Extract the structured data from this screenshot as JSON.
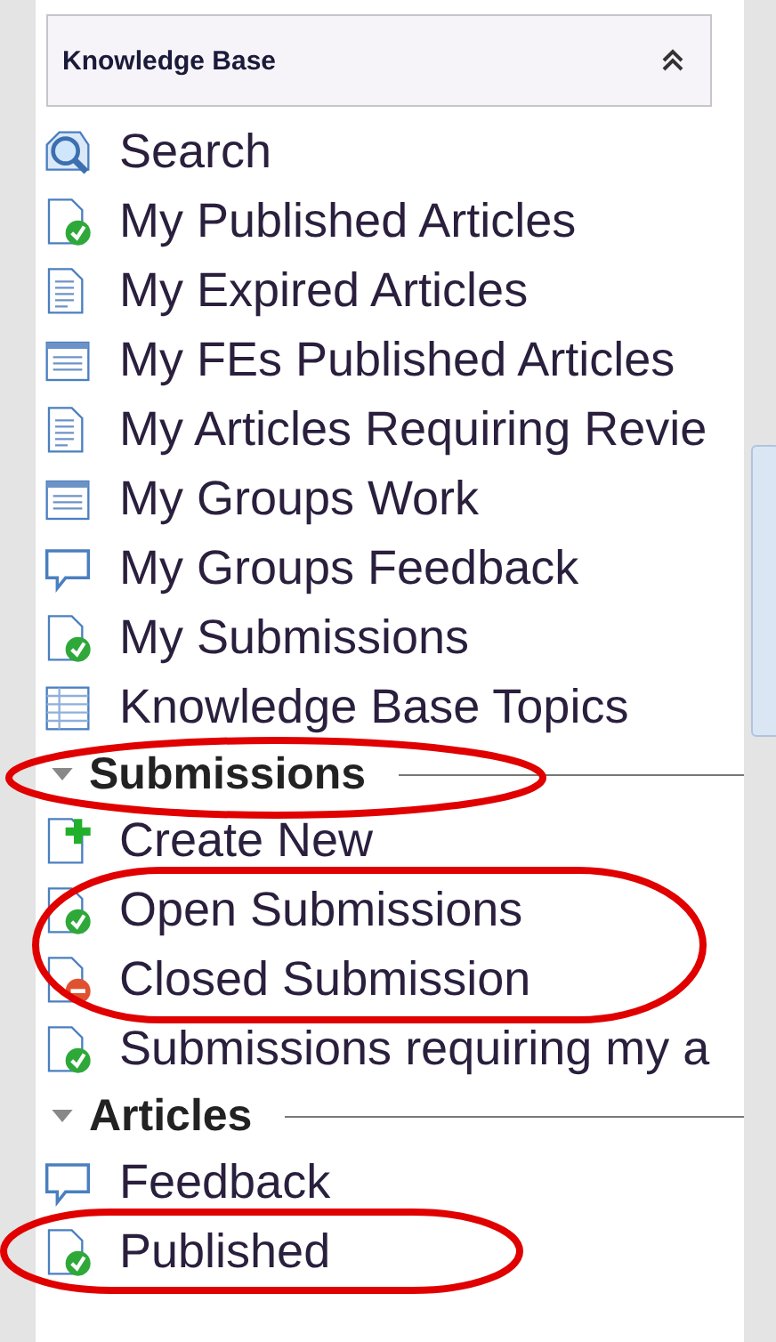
{
  "panel": {
    "title": "Knowledge Base",
    "items": [
      {
        "label": "Search",
        "kind": "search"
      },
      {
        "label": "My Published Articles",
        "kind": "doc-ok"
      },
      {
        "label": "My Expired Articles",
        "kind": "doc-lines"
      },
      {
        "label": "My FEs Published Articles",
        "kind": "window"
      },
      {
        "label": "My Articles Requiring Revie",
        "kind": "doc-lines"
      },
      {
        "label": "My Groups Work",
        "kind": "window"
      },
      {
        "label": "My Groups Feedback",
        "kind": "comment"
      },
      {
        "label": "My Submissions",
        "kind": "doc-ok"
      },
      {
        "label": "Knowledge Base Topics",
        "kind": "table"
      }
    ]
  },
  "groups": [
    {
      "title": "Submissions",
      "expanded": true,
      "items": [
        {
          "label": "Create New",
          "kind": "doc-plus"
        },
        {
          "label": "Open Submissions",
          "kind": "doc-ok"
        },
        {
          "label": "Closed Submission",
          "kind": "doc-minus"
        },
        {
          "label": "Submissions requiring my a",
          "kind": "doc-ok"
        }
      ]
    },
    {
      "title": "Articles",
      "expanded": true,
      "items": [
        {
          "label": "Feedback",
          "kind": "comment"
        },
        {
          "label": "Published",
          "kind": "doc-ok"
        }
      ]
    }
  ]
}
